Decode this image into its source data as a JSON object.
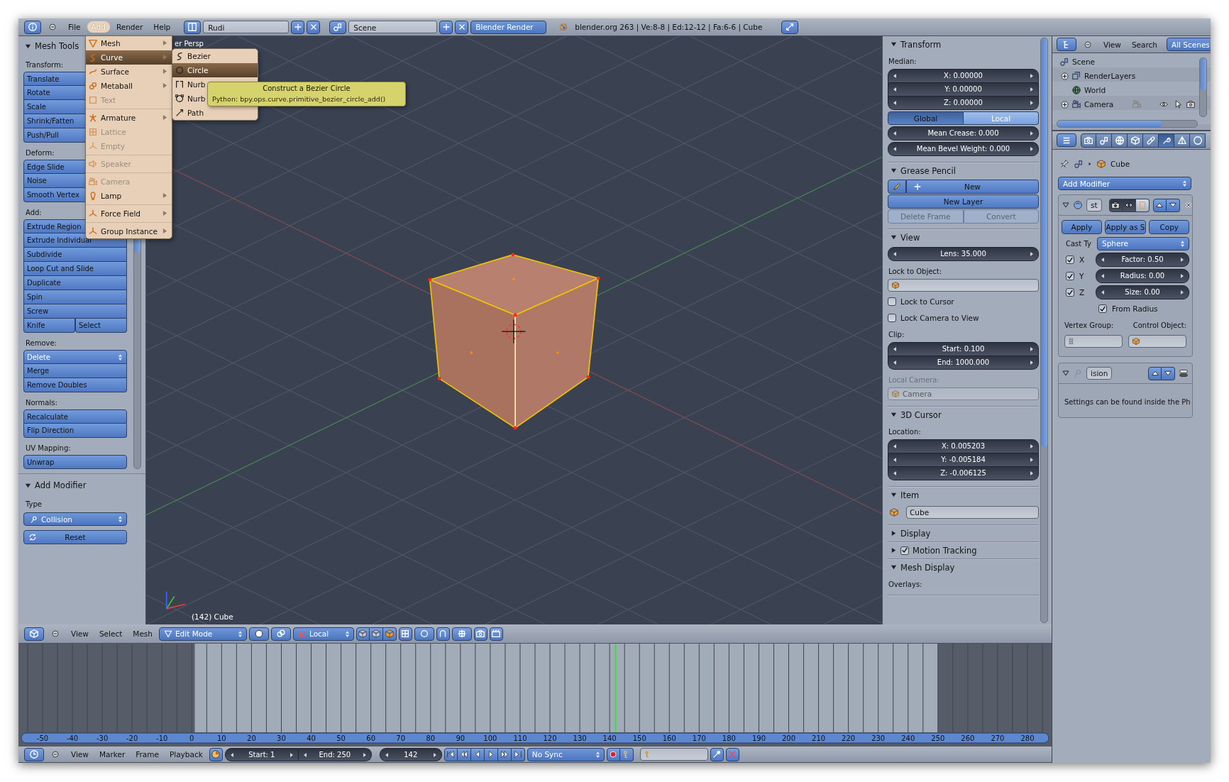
{
  "info_header": {
    "menus": [
      {
        "label": "File",
        "selected": false
      },
      {
        "label": "Add",
        "selected": true
      },
      {
        "label": "Render",
        "selected": false
      },
      {
        "label": "Help",
        "selected": false
      }
    ],
    "screen_layout": "Rudi",
    "scene": "Scene",
    "render_engine": "Blender Render",
    "stats": "blender.org 263 | Ve:8-8 | Ed:12-12 | Fa:6-6 | Cube"
  },
  "add_menu": {
    "sections": [
      [
        {
          "label": "Mesh",
          "kind": "mesh",
          "submenu": true,
          "disabled": false,
          "selected": false
        },
        {
          "label": "Curve",
          "kind": "curve",
          "submenu": true,
          "disabled": false,
          "selected": true
        },
        {
          "label": "Surface",
          "kind": "surface",
          "submenu": true,
          "disabled": false,
          "selected": false
        },
        {
          "label": "Metaball",
          "kind": "metaball",
          "submenu": true,
          "disabled": false,
          "selected": false
        },
        {
          "label": "Text",
          "kind": "text",
          "submenu": false,
          "disabled": true,
          "selected": false
        }
      ],
      [
        {
          "label": "Armature",
          "kind": "armature",
          "submenu": true,
          "disabled": false,
          "selected": false
        },
        {
          "label": "Lattice",
          "kind": "lattice",
          "submenu": false,
          "disabled": true,
          "selected": false
        },
        {
          "label": "Empty",
          "kind": "empty",
          "submenu": false,
          "disabled": true,
          "selected": false
        }
      ],
      [
        {
          "label": "Speaker",
          "kind": "speaker",
          "submenu": false,
          "disabled": true,
          "selected": false
        }
      ],
      [
        {
          "label": "Camera",
          "kind": "camera",
          "submenu": false,
          "disabled": true,
          "selected": false
        },
        {
          "label": "Lamp",
          "kind": "lamp",
          "submenu": true,
          "disabled": false,
          "selected": false
        }
      ],
      [
        {
          "label": "Force Field",
          "kind": "force-field",
          "submenu": true,
          "disabled": false,
          "selected": false
        }
      ],
      [
        {
          "label": "Group Instance",
          "kind": "group",
          "submenu": true,
          "disabled": false,
          "selected": false
        }
      ]
    ]
  },
  "curve_submenu": {
    "items": [
      {
        "label": "Bezier",
        "kind": "bezier",
        "selected": false
      },
      {
        "label": "Circle",
        "kind": "circle",
        "selected": true
      },
      {
        "label": "Nurb",
        "kind": "nurbs-curve",
        "selected": false
      },
      {
        "label": "Nurb",
        "kind": "nurbs-circle",
        "selected": false
      },
      {
        "label": "Path",
        "kind": "path",
        "selected": false
      }
    ]
  },
  "tooltip": {
    "title": "Construct a Bezier Circle",
    "python": "Python: bpy.ops.curve.primitive_bezier_circle_add()"
  },
  "mesh_tools": {
    "title": "Mesh Tools",
    "expanded": true,
    "groups": [
      {
        "label": "Transform:",
        "rows": [
          [
            {
              "label": "Translate",
              "kind": "button"
            }
          ],
          [
            {
              "label": "Rotate",
              "kind": "button"
            }
          ],
          [
            {
              "label": "Scale",
              "kind": "button"
            }
          ],
          [
            {
              "label": "Shrink/Fatten",
              "kind": "button"
            }
          ],
          [
            {
              "label": "Push/Pull",
              "kind": "button"
            }
          ]
        ]
      },
      {
        "label": "Deform:",
        "rows": [
          [
            {
              "label": "Edge Slide",
              "kind": "button"
            }
          ],
          [
            {
              "label": "Noise",
              "kind": "button"
            }
          ],
          [
            {
              "label": "Smooth Vertex",
              "kind": "button"
            }
          ]
        ]
      },
      {
        "label": "Add:",
        "rows": [
          [
            {
              "label": "Extrude Region",
              "kind": "button"
            }
          ],
          [
            {
              "label": "Extrude Individual",
              "kind": "button"
            }
          ],
          [
            {
              "label": "Subdivide",
              "kind": "button"
            }
          ],
          [
            {
              "label": "Loop Cut and Slide",
              "kind": "button"
            }
          ],
          [
            {
              "label": "Duplicate",
              "kind": "button"
            }
          ],
          [
            {
              "label": "Spin",
              "kind": "button"
            }
          ],
          [
            {
              "label": "Screw",
              "kind": "button"
            }
          ],
          [
            {
              "label": "Knife",
              "kind": "button"
            },
            {
              "label": "Select",
              "kind": "button"
            }
          ]
        ]
      },
      {
        "label": "Remove:",
        "rows": [
          [
            {
              "label": "Delete",
              "kind": "dropdown"
            }
          ],
          [
            {
              "label": "Merge",
              "kind": "button"
            }
          ],
          [
            {
              "label": "Remove Doubles",
              "kind": "button"
            }
          ]
        ]
      },
      {
        "label": "Normals:",
        "rows": [
          [
            {
              "label": "Recalculate",
              "kind": "button"
            }
          ],
          [
            {
              "label": "Flip Direction",
              "kind": "button"
            }
          ]
        ]
      },
      {
        "label": "UV Mapping:",
        "rows": [
          [
            {
              "label": "Unwrap",
              "kind": "button"
            }
          ]
        ]
      }
    ]
  },
  "add_modifier_panel": {
    "title": "Add Modifier",
    "expanded": true,
    "type_label": "Type",
    "type": "Collision",
    "reset": "Reset"
  },
  "viewport": {
    "view_name": "er Persp",
    "object_info": "(142) Cube"
  },
  "sidebar": {
    "sections": [
      {
        "title": "Transform",
        "kind": "plain",
        "expanded": true,
        "rows": [
          {
            "kind": "label",
            "text": "Median:",
            "disabled": false
          },
          {
            "kind": "numbers",
            "fields": [
              "X: 0.00000",
              "Y: 0.00000",
              "Z: 0.00000"
            ]
          },
          {
            "kind": "toggle",
            "options": [
              {
                "label": "Global",
                "selected": true
              },
              {
                "label": "Local",
                "selected": false
              }
            ]
          },
          {
            "kind": "numbers",
            "fields": [
              "Mean Crease: 0.000"
            ]
          },
          {
            "kind": "numbers",
            "fields": [
              "Mean Bevel Weight: 0.000"
            ]
          }
        ]
      },
      {
        "title": "Grease Pencil",
        "kind": "plain",
        "expanded": true,
        "rows": [
          {
            "kind": "new",
            "label": "New"
          },
          {
            "kind": "buttons",
            "disabled": false,
            "labels": [
              "New Layer"
            ]
          },
          {
            "kind": "buttons",
            "disabled": true,
            "labels": [
              "Delete Frame",
              "Convert"
            ]
          }
        ]
      },
      {
        "title": "View",
        "kind": "plain",
        "expanded": true,
        "rows": [
          {
            "kind": "numbers",
            "fields": [
              "Lens: 35.000"
            ]
          },
          {
            "kind": "label",
            "text": "Lock to Object:",
            "disabled": false
          },
          {
            "kind": "field",
            "disabled": false
          },
          {
            "kind": "checkbox",
            "label": "Lock to Cursor",
            "checked": false
          },
          {
            "kind": "checkbox",
            "label": "Lock Camera to View",
            "checked": false
          },
          {
            "kind": "label",
            "text": "Clip:",
            "disabled": false
          },
          {
            "kind": "numbers",
            "fields": [
              "Start: 0.100",
              "End: 1000.000"
            ]
          },
          {
            "kind": "label",
            "text": "Local Camera:",
            "disabled": true
          },
          {
            "kind": "field",
            "value": "Camera",
            "disabled": true
          }
        ]
      },
      {
        "title": "3D Cursor",
        "kind": "plain",
        "expanded": true,
        "rows": [
          {
            "kind": "label",
            "text": "Location:",
            "disabled": false
          },
          {
            "kind": "numbers",
            "fields": [
              "X: 0.005203",
              "Y: -0.005184",
              "Z: -0.006125"
            ]
          }
        ]
      },
      {
        "title": "Item",
        "kind": "plain",
        "expanded": true,
        "rows": [
          {
            "kind": "item",
            "value": "Cube"
          }
        ]
      },
      {
        "title": "Display",
        "kind": "plain",
        "expanded": false
      },
      {
        "title": "Motion Tracking",
        "kind": "checkbox",
        "checked": true,
        "expanded": false
      },
      {
        "title": "Mesh Display",
        "kind": "plain",
        "expanded": true,
        "rows": [
          {
            "kind": "label",
            "text": "Overlays:",
            "disabled": false
          }
        ]
      }
    ]
  },
  "outliner": {
    "menus": [
      "View",
      "Search"
    ],
    "filter": "All Scenes",
    "tree": [
      {
        "label": "Scene",
        "kind": "scene",
        "children": [
          {
            "label": "RenderLayers",
            "kind": "renderlayers",
            "expanded": false
          },
          {
            "label": "World",
            "kind": "world"
          },
          {
            "label": "Camera",
            "kind": "camera",
            "expanded": false
          }
        ]
      }
    ]
  },
  "properties_editor": {
    "tabs": [
      {
        "kind": "render",
        "selected": false
      },
      {
        "kind": "scene",
        "selected": false
      },
      {
        "kind": "world",
        "selected": false
      },
      {
        "kind": "object",
        "selected": false
      },
      {
        "kind": "constraints",
        "selected": false
      },
      {
        "kind": "modifiers",
        "selected": true
      },
      {
        "kind": "data",
        "selected": false
      },
      {
        "kind": "material",
        "selected": false
      }
    ],
    "breadcrumb": "Cube",
    "add_modifier": "Add Modifier",
    "modifiers": [
      {
        "kind": "cast",
        "name": "st",
        "expanded": true,
        "buttons": [
          "Apply",
          "Apply as S",
          "Copy"
        ],
        "cast_type_label": "Cast Ty",
        "cast_type": "Sphere",
        "axes": [
          {
            "label": "X",
            "checked": true,
            "field": "Factor: 0.50"
          },
          {
            "label": "Y",
            "checked": true,
            "field": "Radius: 0.00"
          },
          {
            "label": "Z",
            "checked": true,
            "field": "Size: 0.00"
          }
        ],
        "from_radius": {
          "label": "From Radius",
          "checked": true
        },
        "vertex_group_label": "Vertex Group:",
        "control_object_label": "Control Object:"
      },
      {
        "kind": "collision",
        "name": "ision",
        "expanded": true,
        "note": "Settings can be found inside the Ph"
      }
    ]
  },
  "view3d_header": {
    "menus": [
      "View",
      "Select",
      "Mesh"
    ],
    "mode": "Edit Mode",
    "orientation": "Local"
  },
  "timeline": {
    "ruler_labels": [
      "-50",
      "-40",
      "-30",
      "-20",
      "-10",
      "0",
      "10",
      "20",
      "30",
      "40",
      "50",
      "60",
      "70",
      "80",
      "90",
      "100",
      "110",
      "120",
      "130",
      "140",
      "150",
      "160",
      "170",
      "180",
      "190",
      "200",
      "210",
      "220",
      "230",
      "240",
      "250",
      "260",
      "270",
      "280"
    ]
  },
  "timeline_header": {
    "menus": [
      "View",
      "Marker",
      "Frame",
      "Playback"
    ],
    "start": "Start: 1",
    "end": "End: 250",
    "current": "142",
    "sync": "No Sync"
  }
}
